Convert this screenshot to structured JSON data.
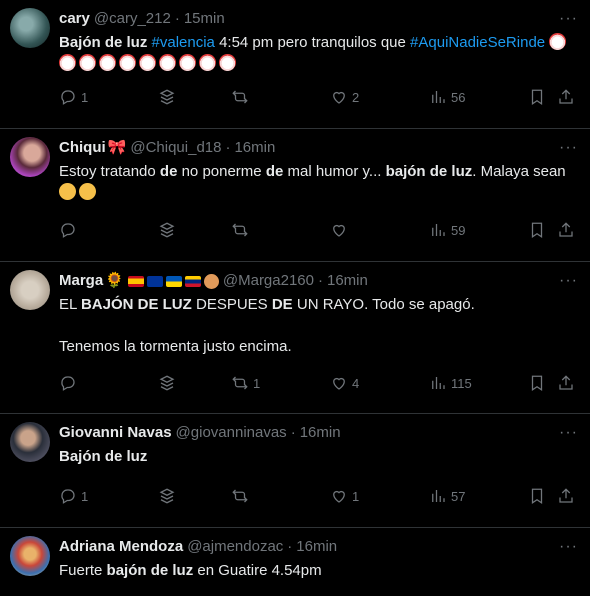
{
  "tweets": [
    {
      "name": "cary",
      "handle": "@cary_212",
      "time": "15min",
      "text_html": "Bajón de luz",
      "text_plain": "#valencia 4:54 pm pero tranquilos que #AquiNadieSeRinde",
      "line1_a": "Bajón de luz",
      "tag1": "#valencia",
      "line1_b": " 4:54 pm pero tranquilos que ",
      "tag2": "#AquiNadieSeRinde",
      "clown_count": 9,
      "replies": "1",
      "retweets": "",
      "likes": "2",
      "views": "56"
    },
    {
      "name": "Chiqui",
      "handle": "@Chiqui_d18",
      "time": "16min",
      "seg": [
        "Estoy tratando ",
        "de",
        " no ponerme ",
        "de",
        " mal humor y... ",
        "bajón de luz",
        ". Malaya sean"
      ],
      "replies": "",
      "retweets": "",
      "likes": "",
      "views": "59"
    },
    {
      "name": "Marga",
      "handle": "@Marga2160",
      "time": "16min",
      "seg": [
        "EL ",
        "BAJÓN DE LUZ",
        " DESPUES ",
        "DE",
        " UN RAYO. Todo se apagó."
      ],
      "line2": "Tenemos la tormenta justo encima.",
      "replies": "",
      "retweets": "1",
      "likes": "4",
      "views": "115"
    },
    {
      "name": "Giovanni Navas",
      "handle": "@giovanninavas",
      "time": "16min",
      "text": "Bajón de luz",
      "replies": "1",
      "retweets": "",
      "likes": "1",
      "views": "57"
    },
    {
      "name": "Adriana Mendoza",
      "handle": "@ajmendozac",
      "time": "16min",
      "seg": [
        "Fuerte ",
        "bajón de luz",
        " en Guatire 4.54pm"
      ]
    }
  ],
  "dot": "·",
  "more": "···",
  "icons": [
    "reply-icon",
    "retweet-icon",
    "like-icon",
    "views-icon",
    "bookmark-icon",
    "share-icon",
    "grok-icon"
  ]
}
